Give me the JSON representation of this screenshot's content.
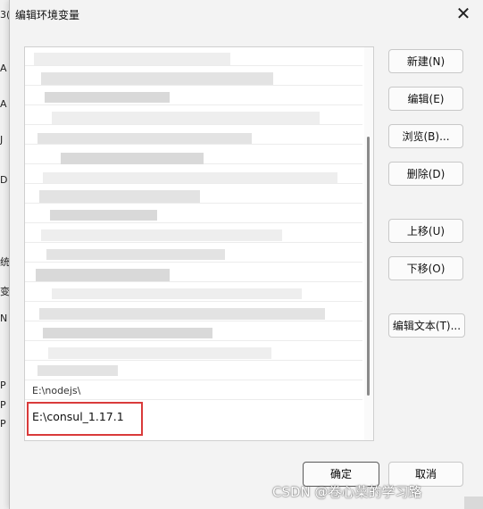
{
  "window": {
    "title": "编辑环境变量",
    "close_label": "✕"
  },
  "background": {
    "fragments": [
      "3(",
      "A",
      "A",
      "J",
      "D",
      "统",
      "变",
      "N",
      "P",
      "P",
      "P"
    ]
  },
  "list": {
    "visible_items": [
      "E:\\nodejs\\"
    ],
    "selected_item": "E:\\consul_1.17.1"
  },
  "buttons": {
    "new": "新建(N)",
    "edit": "编辑(E)",
    "browse": "浏览(B)...",
    "delete": "删除(D)",
    "move_up": "上移(U)",
    "move_down": "下移(O)",
    "edit_text": "编辑文本(T)...",
    "ok": "确定",
    "cancel": "取消"
  },
  "watermark": "CSDN @卷心菜的学习路"
}
